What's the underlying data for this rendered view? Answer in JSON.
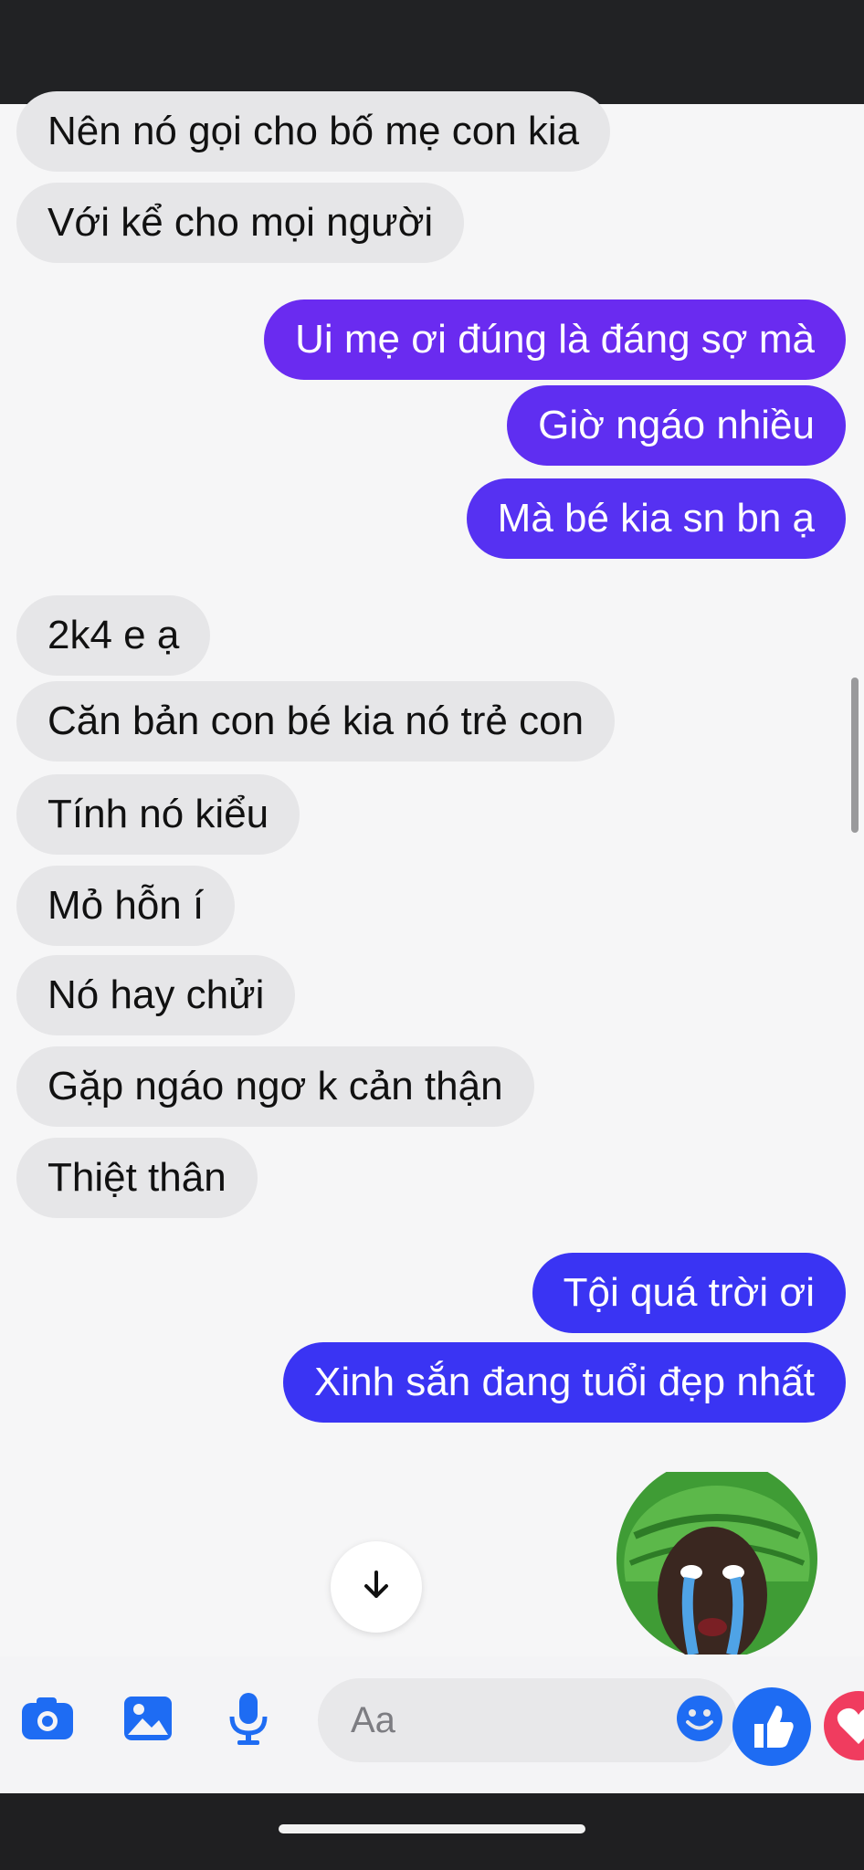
{
  "colors": {
    "outgoing_blue": "#3a34f3",
    "outgoing_violet": "#6a2bf0",
    "incoming": "#e6e6e8",
    "accent": "#1e6cf3"
  },
  "messages": [
    {
      "side": "in",
      "text": "Nên nó gọi cho bố mẹ con kia"
    },
    {
      "side": "in",
      "text": "Với kể cho mọi người"
    },
    {
      "side": "out",
      "text": "Ui mẹ ơi đúng là đáng sợ mà"
    },
    {
      "side": "out",
      "text": "Giờ ngáo nhiều"
    },
    {
      "side": "out",
      "text": "Mà bé kia sn bn ạ"
    },
    {
      "side": "in",
      "text": "2k4 e ạ"
    },
    {
      "side": "in",
      "text": "Căn bản con bé kia nó trẻ con"
    },
    {
      "side": "in",
      "text": "Tính nó kiểu"
    },
    {
      "side": "in",
      "text": "Mỏ hỗn í"
    },
    {
      "side": "in",
      "text": "Nó hay chửi"
    },
    {
      "side": "in",
      "text": "Gặp ngáo ngơ k cản thận"
    },
    {
      "side": "in",
      "text": "Thiệt thân"
    },
    {
      "side": "out",
      "text": "Tội quá trời ơi"
    },
    {
      "side": "out",
      "text": "Xinh sắn đang tuổi đẹp nhất"
    }
  ],
  "scroll_down_icon": "arrow-down-icon",
  "sticker": "crying-face-sticker",
  "composer": {
    "placeholder": "Aa",
    "icons": [
      "camera-icon",
      "image-icon",
      "microphone-icon",
      "emoji-icon",
      "like-icon",
      "heart-icon"
    ]
  }
}
